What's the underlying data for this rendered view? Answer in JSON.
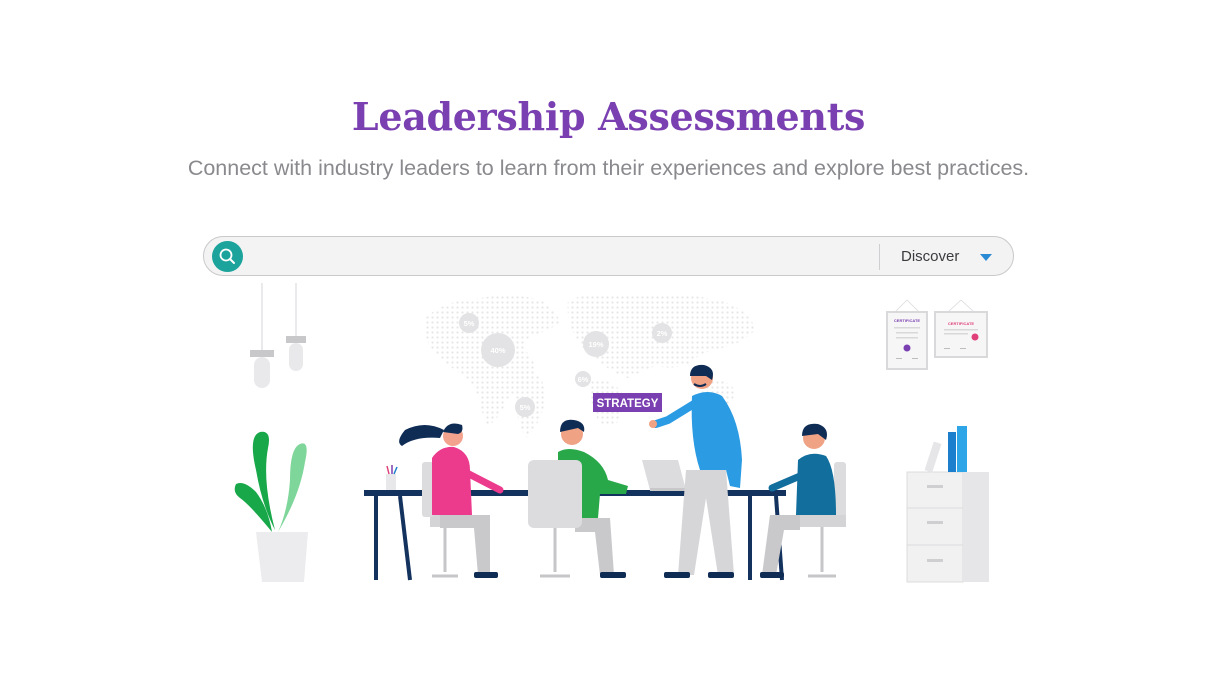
{
  "header": {
    "title": "Leadership Assessments",
    "subtitle": "Connect with industry leaders to learn from their experiences and explore best practices."
  },
  "search": {
    "value": "",
    "placeholder": "",
    "filter_selected": "Discover"
  },
  "illustration": {
    "board_label": "STRATEGY",
    "map_stats": [
      "5%",
      "40%",
      "19%",
      "2%",
      "6%",
      "5%"
    ],
    "certificate_titles": [
      "CERTIFICATE",
      "CERTIFICATE"
    ]
  },
  "colors": {
    "title": "#7a3fb0",
    "subtitle": "#8a8a8e",
    "search_button": "#1ba39c",
    "chevron": "#2a8ad4",
    "strategy_tag": "#7a3fb0"
  },
  "icons": {
    "search": "search-icon",
    "dropdown": "chevron-down-icon"
  }
}
